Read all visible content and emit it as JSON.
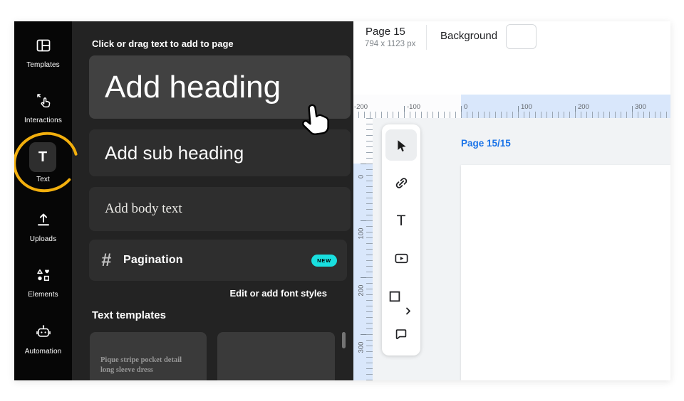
{
  "sidebar": {
    "items": [
      {
        "label": "Templates",
        "icon": "templates-icon"
      },
      {
        "label": "Interactions",
        "icon": "interactions-icon"
      },
      {
        "label": "Text",
        "icon": "text-icon",
        "glyph": "T",
        "active": true
      },
      {
        "label": "Uploads",
        "icon": "uploads-icon"
      },
      {
        "label": "Elements",
        "icon": "elements-icon"
      },
      {
        "label": "Automation",
        "icon": "automation-icon"
      }
    ]
  },
  "panel": {
    "title": "Click or drag text to add to page",
    "add_heading": "Add heading",
    "add_subheading": "Add sub heading",
    "add_body": "Add body text",
    "pagination": {
      "hash": "#",
      "label": "Pagination",
      "badge": "NEW"
    },
    "font_styles_link": "Edit or add font styles",
    "templates_heading": "Text templates",
    "template_cards": [
      {
        "text": "Pique stripe pocket detail long sleeve dress"
      },
      {
        "text": ""
      }
    ]
  },
  "header": {
    "page_title": "Page 15",
    "page_dimensions": "794 x 1123 px",
    "background_label": "Background",
    "background_color": "#ffffff"
  },
  "canvas": {
    "page_indicator": "Page 15/15",
    "h_ruler": [
      "-200",
      "-100",
      "0",
      "100",
      "200",
      "300"
    ],
    "v_ruler": [
      "0",
      "100",
      "200",
      "300"
    ],
    "tools": [
      "select",
      "link",
      "text",
      "video",
      "shape",
      "comment"
    ],
    "text_tool_glyph": "T"
  },
  "colors": {
    "accent_blue": "#1a73e8",
    "badge_cyan": "#19dfdf",
    "annotation_yellow": "#f2af0d",
    "ruler_blue": "#d9e7fb",
    "panel_bg": "#232323",
    "sidebar_bg": "#060606"
  }
}
